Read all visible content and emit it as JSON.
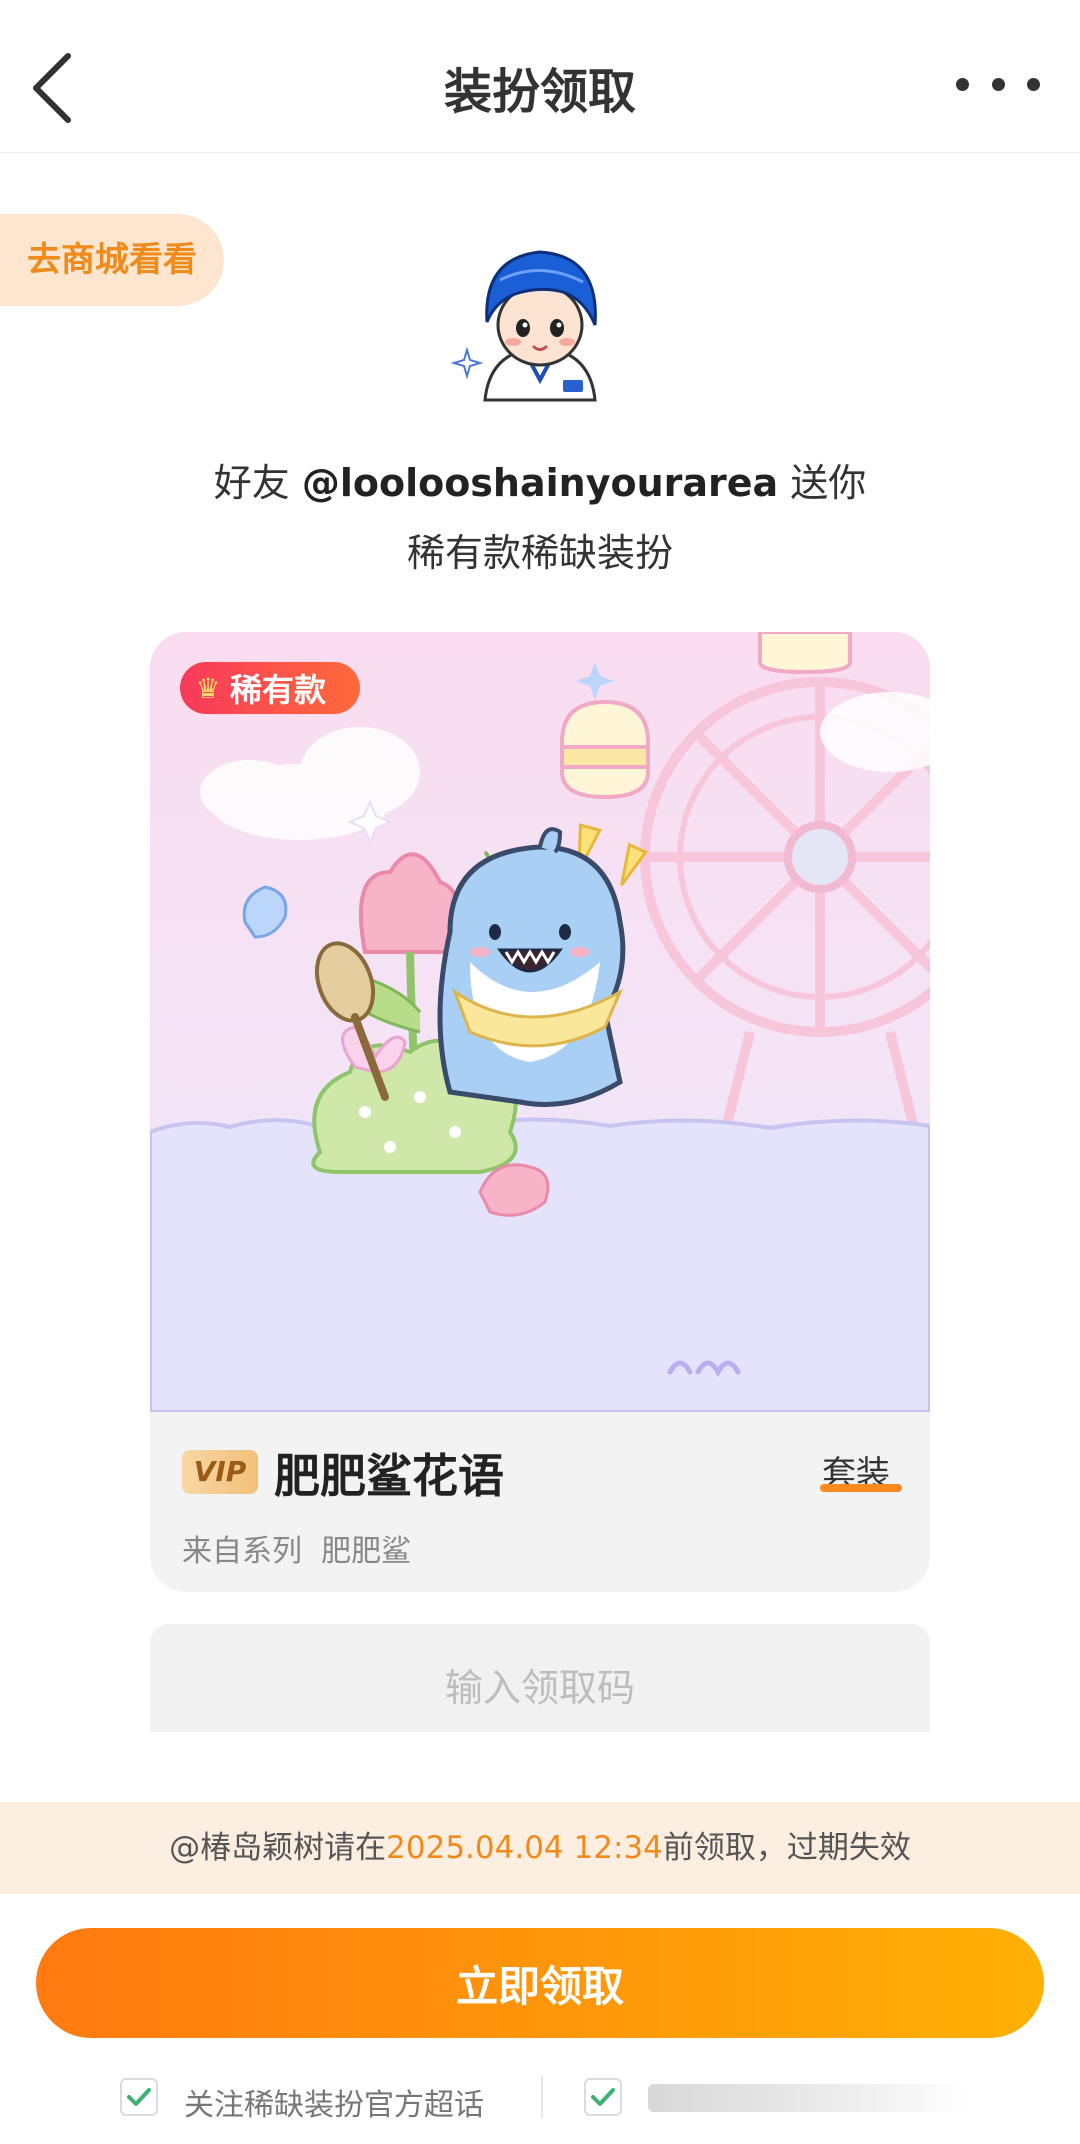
{
  "header": {
    "title": "装扮领取"
  },
  "shop_button": "去商城看看",
  "gift": {
    "prefix": "好友 ",
    "username": "@loolooshainyourarea",
    "suffix": " 送你",
    "line2": "稀有款稀缺装扮"
  },
  "card": {
    "rarity_badge": "稀有款",
    "vip_badge": "VIP",
    "item_name": "肥肥鲨花语",
    "type_label": "套装",
    "series_label": "来自系列",
    "series_name": "肥肥鲨"
  },
  "code_input": {
    "placeholder": "输入领取码",
    "value": ""
  },
  "notice": {
    "prefix": "@椿岛颖树请在",
    "date": "2025.04.04 12:34",
    "suffix": "前领取，过期失效"
  },
  "claim_button": "立即领取",
  "options": [
    {
      "label": "关注稀缺装扮官方超话",
      "checked": true
    },
    {
      "label": "",
      "checked": true
    }
  ],
  "colors": {
    "accent": "#f08a1a",
    "button_start": "#ff7a10",
    "button_end": "#ffb005",
    "rare_badge": "#f8395b",
    "checkmark": "#3cb371"
  }
}
